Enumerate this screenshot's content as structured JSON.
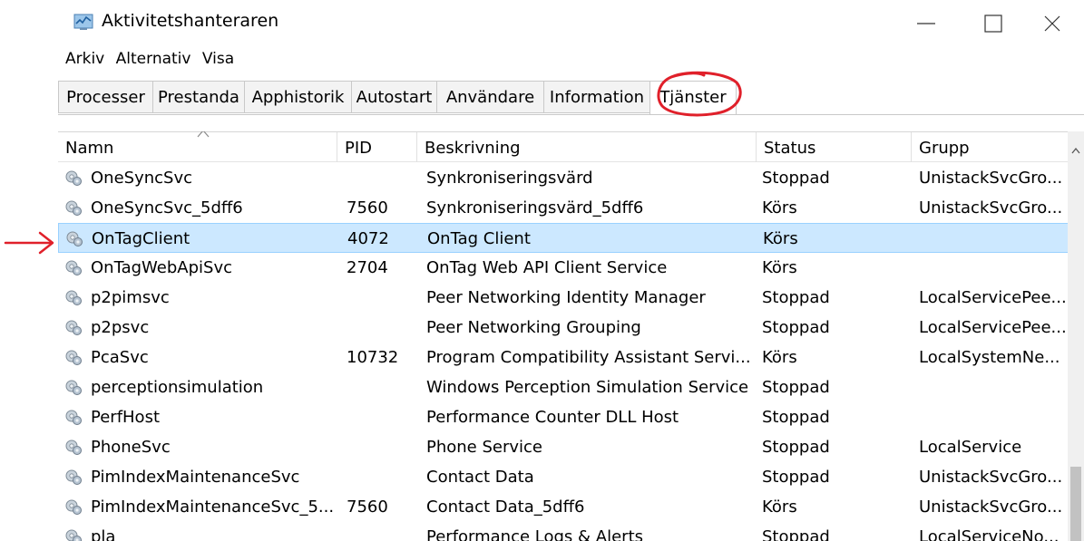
{
  "window": {
    "title": "Aktivitetshanteraren"
  },
  "menu": [
    "Arkiv",
    "Alternativ",
    "Visa"
  ],
  "tabs": [
    "Processer",
    "Prestanda",
    "Apphistorik",
    "Autostart",
    "Användare",
    "Information",
    "Tjänster"
  ],
  "active_tab": "Tjänster",
  "columns": [
    "Namn",
    "PID",
    "Beskrivning",
    "Status",
    "Grupp"
  ],
  "rows": [
    {
      "name": "OneSyncSvc",
      "pid": "",
      "desc": "Synkroniseringsvärd",
      "status": "Stoppad",
      "group": "UnistackSvcGro..."
    },
    {
      "name": "OneSyncSvc_5dff6",
      "pid": "7560",
      "desc": "Synkroniseringsvärd_5dff6",
      "status": "Körs",
      "group": "UnistackSvcGro..."
    },
    {
      "name": "OnTagClient",
      "pid": "4072",
      "desc": "OnTag Client",
      "status": "Körs",
      "group": ""
    },
    {
      "name": "OnTagWebApiSvc",
      "pid": "2704",
      "desc": "OnTag Web API Client Service",
      "status": "Körs",
      "group": ""
    },
    {
      "name": "p2pimsvc",
      "pid": "",
      "desc": "Peer Networking Identity Manager",
      "status": "Stoppad",
      "group": "LocalServicePee..."
    },
    {
      "name": "p2psvc",
      "pid": "",
      "desc": "Peer Networking Grouping",
      "status": "Stoppad",
      "group": "LocalServicePee..."
    },
    {
      "name": "PcaSvc",
      "pid": "10732",
      "desc": "Program Compatibility Assistant Servi...",
      "status": "Körs",
      "group": "LocalSystemNe..."
    },
    {
      "name": "perceptionsimulation",
      "pid": "",
      "desc": "Windows Perception Simulation Service",
      "status": "Stoppad",
      "group": ""
    },
    {
      "name": "PerfHost",
      "pid": "",
      "desc": "Performance Counter DLL Host",
      "status": "Stoppad",
      "group": ""
    },
    {
      "name": "PhoneSvc",
      "pid": "",
      "desc": "Phone Service",
      "status": "Stoppad",
      "group": "LocalService"
    },
    {
      "name": "PimIndexMaintenanceSvc",
      "pid": "",
      "desc": "Contact Data",
      "status": "Stoppad",
      "group": "UnistackSvcGro..."
    },
    {
      "name": "PimIndexMaintenanceSvc_5...",
      "pid": "7560",
      "desc": "Contact Data_5dff6",
      "status": "Körs",
      "group": "UnistackSvcGro..."
    },
    {
      "name": "pla",
      "pid": "",
      "desc": "Performance Logs & Alerts",
      "status": "Stoppad",
      "group": "LocalServiceNo..."
    }
  ],
  "selected_row": "OnTagClient",
  "colors": {
    "selection": "#cce8ff",
    "annotation": "#e0202a"
  },
  "icons": {
    "app": "task-manager-icon",
    "service": "gear-service-icon"
  }
}
